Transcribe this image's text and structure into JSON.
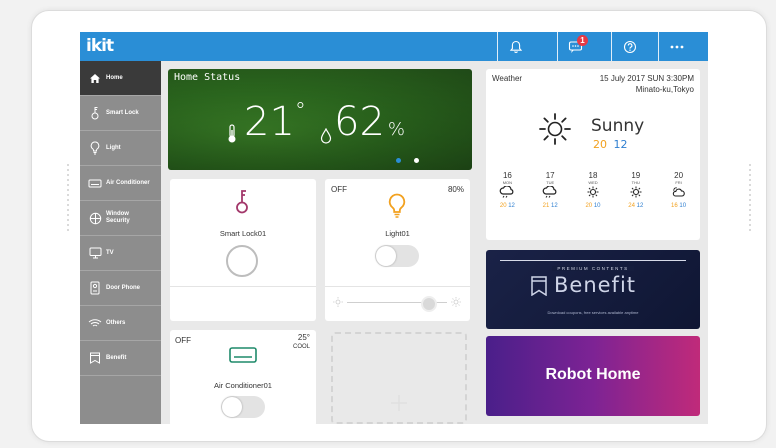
{
  "app": {
    "logo": "ikit"
  },
  "header": {
    "notifications_badge": "1"
  },
  "sidebar": {
    "items": [
      {
        "label": "Home",
        "icon": "home-icon"
      },
      {
        "label": "Smart Lock",
        "icon": "key-icon"
      },
      {
        "label": "Light",
        "icon": "bulb-icon"
      },
      {
        "label": "Air Conditioner",
        "icon": "aircon-icon"
      },
      {
        "label": "Window Security",
        "icon": "window-icon"
      },
      {
        "label": "TV",
        "icon": "tv-icon"
      },
      {
        "label": "Door Phone",
        "icon": "doorphone-icon"
      },
      {
        "label": "Others",
        "icon": "wifi-icon"
      },
      {
        "label": "Benefit",
        "icon": "bookmark-icon"
      }
    ]
  },
  "home_status": {
    "title": "Home Status",
    "temperature": "21",
    "temp_unit": "°",
    "humidity": "62",
    "humidity_unit": "%"
  },
  "weather": {
    "label": "Weather",
    "date": "15 July 2017 SUN",
    "time": "3:30PM",
    "location": "Minato-ku,Tokyo",
    "condition": "Sunny",
    "high": "20",
    "low": "12",
    "forecast": [
      {
        "day": "16",
        "dow": "MON",
        "icon": "cloud-rain-icon",
        "high": "20",
        "low": "12"
      },
      {
        "day": "17",
        "dow": "TUE",
        "icon": "cloud-rain-icon",
        "high": "21",
        "low": "12"
      },
      {
        "day": "18",
        "dow": "WED",
        "icon": "sun-icon",
        "high": "20",
        "low": "10"
      },
      {
        "day": "19",
        "dow": "THU",
        "icon": "sun-icon",
        "high": "24",
        "low": "12"
      },
      {
        "day": "20",
        "dow": "FRI",
        "icon": "sun-cloud-icon",
        "high": "16",
        "low": "10"
      }
    ]
  },
  "smart_lock": {
    "name": "Smart Lock01"
  },
  "light": {
    "state": "OFF",
    "brightness": "80%",
    "name": "Light01"
  },
  "aircon": {
    "state": "OFF",
    "temperature": "25°",
    "mode": "COOL",
    "name": "Air Conditioner01"
  },
  "benefit_card": {
    "tag": "PREMIUM CONTENTS",
    "title": "Benefit",
    "subtitle": "Download coupons, free services available anytime"
  },
  "robot_card": {
    "title": "Robot Home"
  },
  "colors": {
    "primary": "#2a8ed6",
    "accent_orange": "#f2a11f",
    "lock_pink": "#a3386b",
    "high_temp": "#f2a11f",
    "low_temp": "#2f7fd0"
  }
}
